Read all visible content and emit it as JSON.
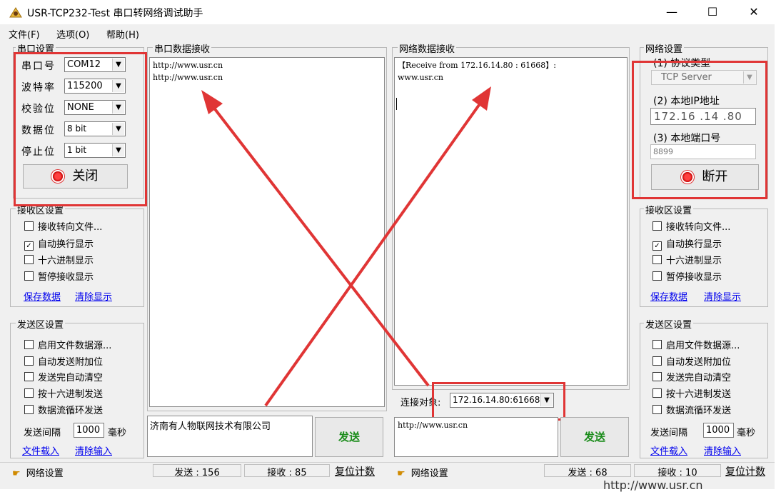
{
  "window": {
    "title": "USR-TCP232-Test 串口转网络调试助手",
    "minimize": "—",
    "maximize": "☐",
    "close": "✕"
  },
  "menu": [
    "文件(F)",
    "选项(O)",
    "帮助(H)"
  ],
  "serial_settings": {
    "legend": "串口设置",
    "port_label": "串口号",
    "port_value": "COM12",
    "baud_label": "波特率",
    "baud_value": "115200",
    "parity_label": "校验位",
    "parity_value": "NONE",
    "databits_label": "数据位",
    "databits_value": "8 bit",
    "stopbits_label": "停止位",
    "stopbits_value": "1 bit",
    "close_button": "关闭"
  },
  "left_recv_settings": {
    "legend": "接收区设置",
    "options": [
      {
        "label": "接收转向文件...",
        "checked": false
      },
      {
        "label": "自动换行显示",
        "checked": true
      },
      {
        "label": "十六进制显示",
        "checked": false
      },
      {
        "label": "暂停接收显示",
        "checked": false
      }
    ],
    "save_link": "保存数据",
    "clear_link": "清除显示"
  },
  "left_send_settings": {
    "legend": "发送区设置",
    "options": [
      {
        "label": "启用文件数据源...",
        "checked": false
      },
      {
        "label": "自动发送附加位",
        "checked": false
      },
      {
        "label": "发送完自动清空",
        "checked": false
      },
      {
        "label": "按十六进制发送",
        "checked": false
      },
      {
        "label": "数据流循环发送",
        "checked": false
      }
    ],
    "interval_label": "发送间隔",
    "interval_value": "1000",
    "interval_unit": "毫秒",
    "load_link": "文件载入",
    "clear_link": "清除输入"
  },
  "serial_recv": {
    "legend": "串口数据接收",
    "content": "http://www.usr.cn\nhttp://www.usr.cn"
  },
  "serial_send": {
    "content": "济南有人物联网技术有限公司",
    "send_button": "发送"
  },
  "net_recv": {
    "legend": "网络数据接收",
    "content": "【Receive from 172.16.14.80 : 61668】:\nwww.usr.cn"
  },
  "connection": {
    "label": "连接对象:",
    "value": "172.16.14.80:61668"
  },
  "net_send": {
    "content": "http://www.usr.cn",
    "send_button": "发送"
  },
  "net_settings": {
    "legend": "网络设置",
    "protocol_label": "(1) 协议类型",
    "protocol_value": "TCP Server",
    "ip_label": "(2) 本地IP地址",
    "ip_parts": [
      "172",
      "16",
      "14",
      "80"
    ],
    "port_label": "(3) 本地端口号",
    "port_value": "8899",
    "disconnect_button": "断开"
  },
  "right_recv_settings": {
    "legend": "接收区设置",
    "options": [
      {
        "label": "接收转向文件...",
        "checked": false
      },
      {
        "label": "自动换行显示",
        "checked": true
      },
      {
        "label": "十六进制显示",
        "checked": false
      },
      {
        "label": "暂停接收显示",
        "checked": false
      }
    ],
    "save_link": "保存数据",
    "clear_link": "清除显示"
  },
  "right_send_settings": {
    "legend": "发送区设置",
    "options": [
      {
        "label": "启用文件数据源...",
        "checked": false
      },
      {
        "label": "自动发送附加位",
        "checked": false
      },
      {
        "label": "发送完自动清空",
        "checked": false
      },
      {
        "label": "按十六进制发送",
        "checked": false
      },
      {
        "label": "数据流循环发送",
        "checked": false
      }
    ],
    "interval_label": "发送间隔",
    "interval_value": "1000",
    "interval_unit": "毫秒",
    "load_link": "文件载入",
    "clear_link": "清除输入"
  },
  "statusbar": {
    "left_label": "网络设置",
    "serial_sent": "发送 : 156",
    "serial_recv": "接收 : 85",
    "serial_reset": "复位计数",
    "right_label": "网络设置",
    "net_sent": "发送 : 68",
    "net_recv": "接收 : 10",
    "net_reset": "复位计数"
  },
  "background_text": "http://www.usr.cn",
  "colors": {
    "annotation_red": "#e03535",
    "link_blue": "#0000ee",
    "send_green": "#1a8c1a"
  }
}
